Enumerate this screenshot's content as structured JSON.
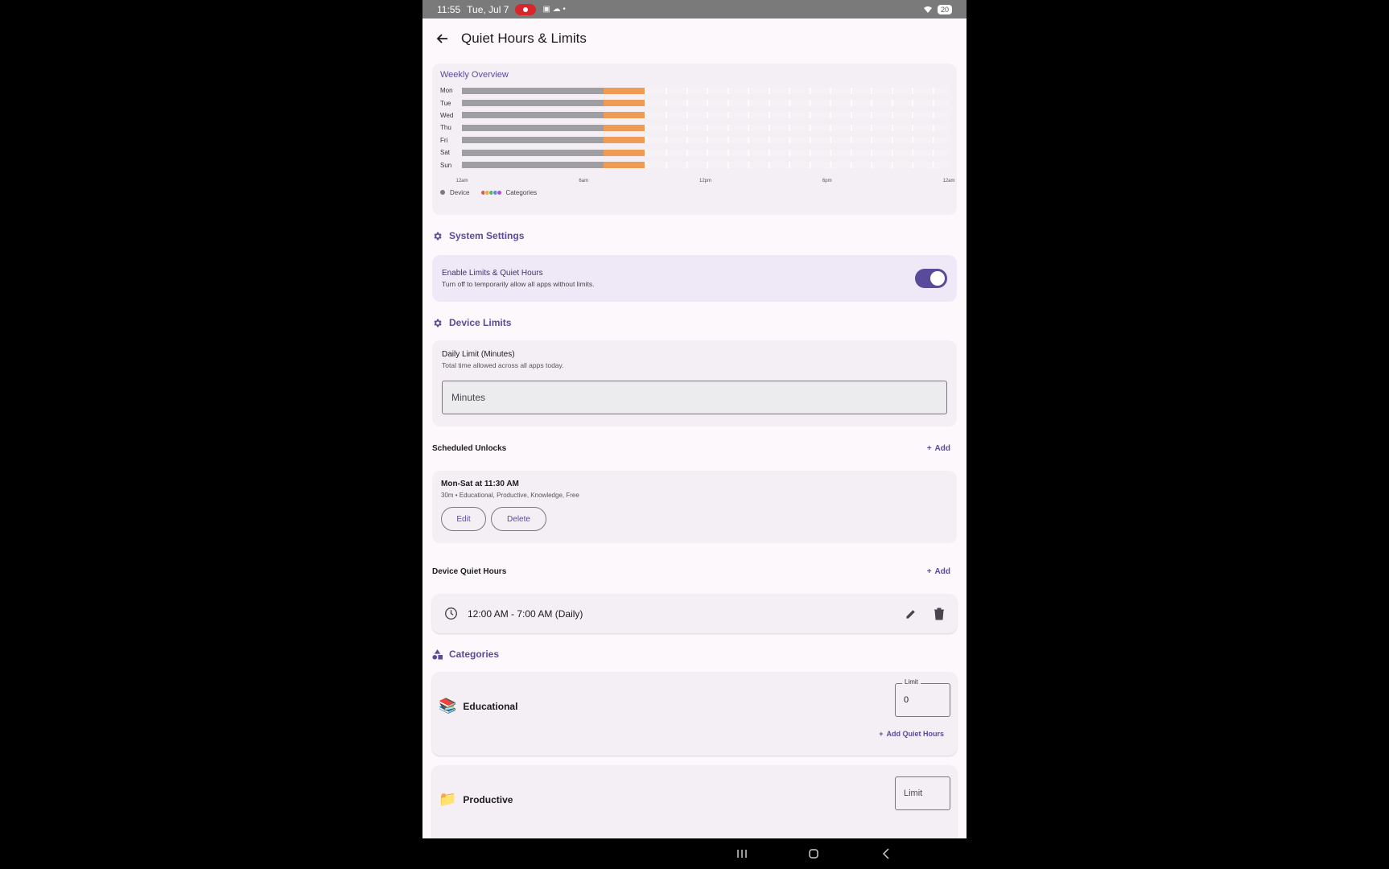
{
  "status_bar": {
    "time": "11:55",
    "date": "Tue, Jul 7",
    "battery": "20"
  },
  "app_bar": {
    "title": "Quiet Hours & Limits"
  },
  "weekly_overview": {
    "title": "Weekly Overview",
    "days": [
      "Mon",
      "Tue",
      "Wed",
      "Thu",
      "Fri",
      "Sat",
      "Sun"
    ],
    "axis_ticks": [
      "12am",
      "6am",
      "12pm",
      "6pm",
      "12am"
    ],
    "legend_device": "Device",
    "legend_categories": "Categories",
    "category_dot_colors": [
      "#e05a4f",
      "#f2a53a",
      "#58b36b",
      "#4f8fe0",
      "#b24fd6"
    ],
    "device_color": "#9f9ea3",
    "category_color": "#ef9a55"
  },
  "chart_data": {
    "type": "bar",
    "categories": [
      "Mon",
      "Tue",
      "Wed",
      "Thu",
      "Fri",
      "Sat",
      "Sun"
    ],
    "series": [
      {
        "name": "Device",
        "start_hour": 0,
        "end_hour": 7
      },
      {
        "name": "Categories",
        "start_hour": 7,
        "end_hour": 9
      }
    ],
    "xlim": [
      0,
      24
    ]
  },
  "system_settings": {
    "title": "System Settings",
    "enable_title": "Enable Limits & Quiet Hours",
    "enable_subtitle": "Turn off to temporarily allow all apps without limits.",
    "enabled": true
  },
  "device_limits": {
    "title": "Device Limits",
    "daily_title": "Daily Limit (Minutes)",
    "daily_subtitle": "Total time allowed across all apps today.",
    "minutes_placeholder": "Minutes"
  },
  "scheduled_unlocks": {
    "title": "Scheduled Unlocks",
    "add_label": "Add",
    "item_title": "Mon-Sat at 11:30 AM",
    "item_subtitle": "30m • Educational, Productive, Knowledge, Free",
    "edit_label": "Edit",
    "delete_label": "Delete"
  },
  "device_quiet_hours": {
    "title": "Device Quiet Hours",
    "add_label": "Add",
    "item": "12:00 AM - 7:00 AM (Daily)"
  },
  "categories": {
    "title": "Categories",
    "items": [
      {
        "name": "Educational",
        "limit_label": "Limit",
        "limit_value": "0",
        "add_quiet": "Add Quiet Hours"
      },
      {
        "name": "Productive",
        "limit_placeholder": "Limit"
      }
    ]
  }
}
